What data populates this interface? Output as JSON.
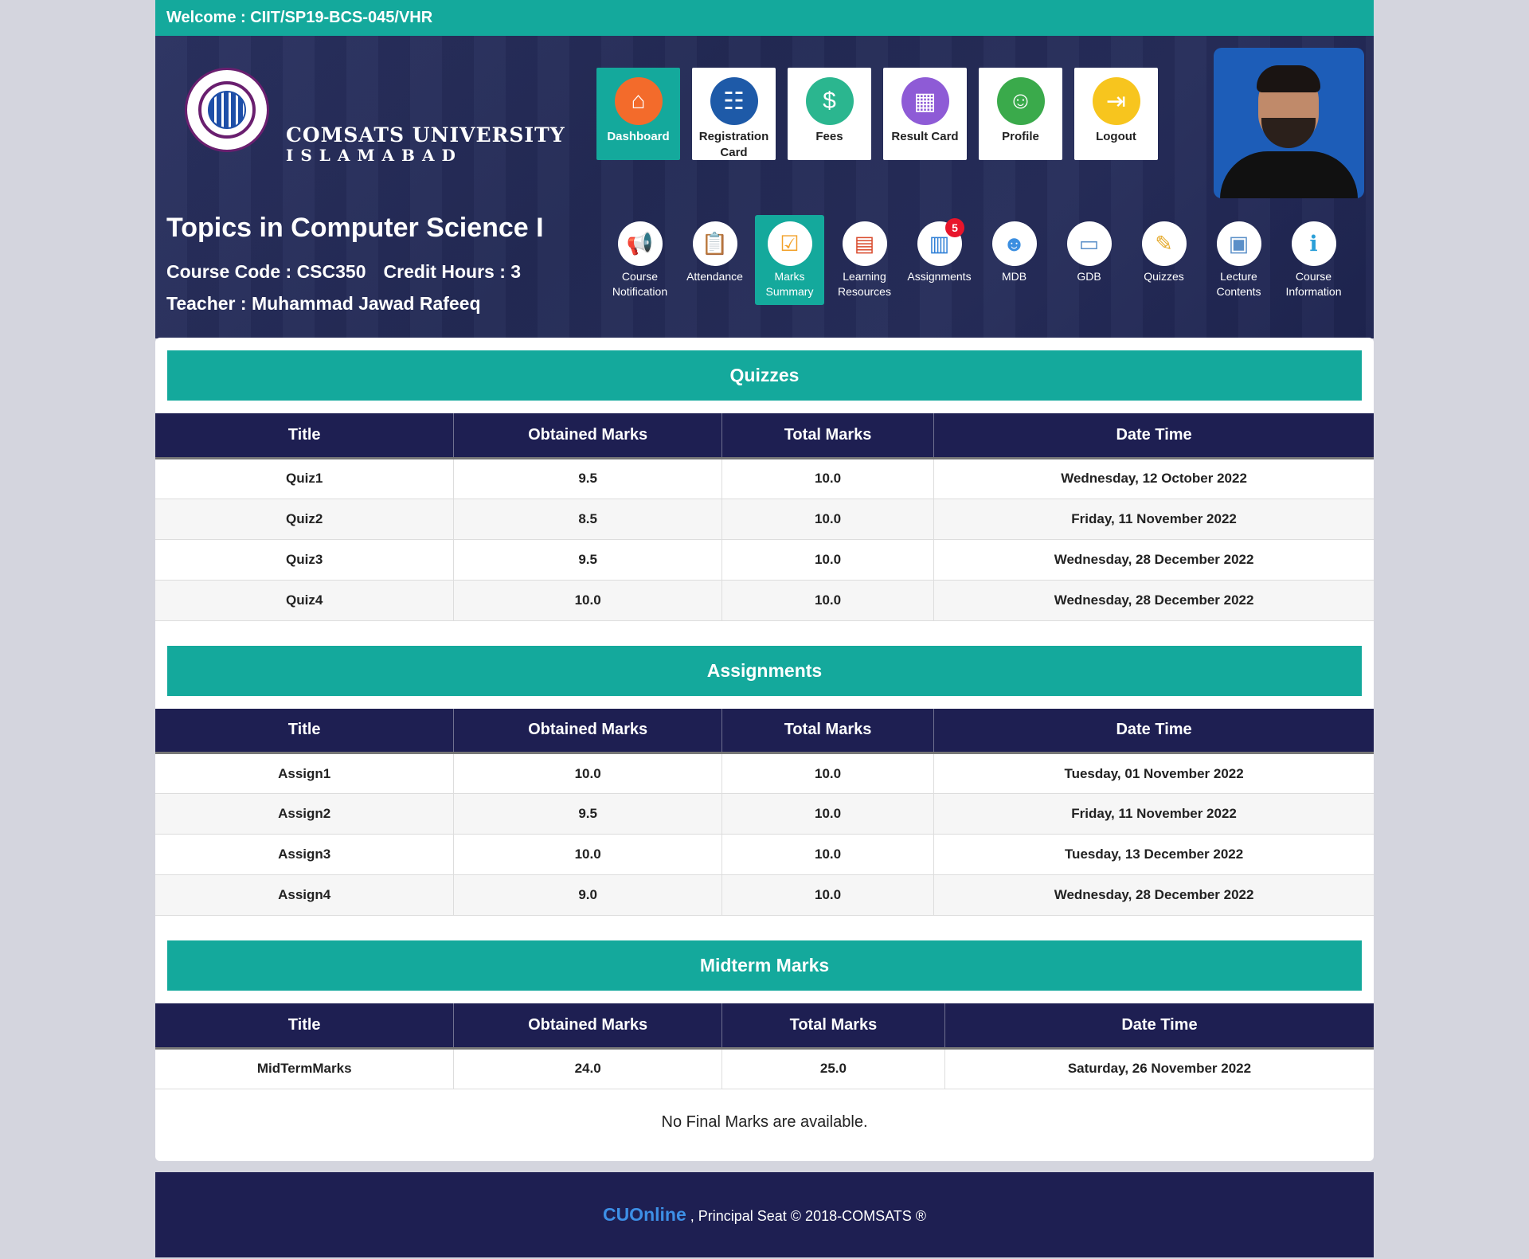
{
  "welcome": "Welcome : CIIT/SP19-BCS-045/VHR",
  "brand": {
    "line1": "COMSATS UNIVERSITY",
    "line2": "ISLAMABAD"
  },
  "topnav": [
    {
      "label": "Dashboard",
      "icon": "home-icon",
      "color": "#f36b2b",
      "active": true
    },
    {
      "label": "Registration Card",
      "icon": "registration-icon",
      "color": "#1e5aa8",
      "active": false
    },
    {
      "label": "Fees",
      "icon": "fees-icon",
      "color": "#2bb68f",
      "active": false
    },
    {
      "label": "Result Card",
      "icon": "result-card-icon",
      "color": "#8e5bd6",
      "active": false
    },
    {
      "label": "Profile",
      "icon": "profile-icon",
      "color": "#3aaa4b",
      "active": false
    },
    {
      "label": "Logout",
      "icon": "logout-icon",
      "color": "#f7c51e",
      "active": false
    }
  ],
  "course": {
    "title": "Topics in Computer Science I",
    "code": "Course Code : CSC350",
    "credit": "Credit Hours : 3",
    "teacher": "Teacher : Muhammad Jawad Rafeeq"
  },
  "subnav": [
    {
      "label": "Course Notification",
      "icon": "megaphone-icon",
      "active": false
    },
    {
      "label": "Attendance",
      "icon": "clipboard-icon",
      "active": false
    },
    {
      "label": "Marks Summary",
      "icon": "marks-summary-icon",
      "active": true
    },
    {
      "label": "Learning Resources",
      "icon": "learning-resources-icon",
      "active": false
    },
    {
      "label": "Assignments",
      "icon": "assignments-icon",
      "active": false,
      "badge": "5"
    },
    {
      "label": "MDB",
      "icon": "mdb-icon",
      "active": false
    },
    {
      "label": "GDB",
      "icon": "gdb-icon",
      "active": false
    },
    {
      "label": "Quizzes",
      "icon": "quizzes-icon",
      "active": false
    },
    {
      "label": "Lecture Contents",
      "icon": "lecture-contents-icon",
      "active": false
    },
    {
      "label": "Course Information",
      "icon": "info-icon",
      "active": false
    }
  ],
  "headers": [
    "Title",
    "Obtained Marks",
    "Total Marks",
    "Date Time"
  ],
  "quizzes": {
    "heading": "Quizzes",
    "rows": [
      [
        "Quiz1",
        "9.5",
        "10.0",
        "Wednesday, 12 October 2022"
      ],
      [
        "Quiz2",
        "8.5",
        "10.0",
        "Friday, 11 November 2022"
      ],
      [
        "Quiz3",
        "9.5",
        "10.0",
        "Wednesday, 28 December 2022"
      ],
      [
        "Quiz4",
        "10.0",
        "10.0",
        "Wednesday, 28 December 2022"
      ]
    ]
  },
  "assignments": {
    "heading": "Assignments",
    "rows": [
      [
        "Assign1",
        "10.0",
        "10.0",
        "Tuesday, 01 November 2022"
      ],
      [
        "Assign2",
        "9.5",
        "10.0",
        "Friday, 11 November 2022"
      ],
      [
        "Assign3",
        "10.0",
        "10.0",
        "Tuesday, 13 December 2022"
      ],
      [
        "Assign4",
        "9.0",
        "10.0",
        "Wednesday, 28 December 2022"
      ]
    ]
  },
  "midterm": {
    "heading": "Midterm Marks",
    "rows": [
      [
        "MidTermMarks",
        "24.0",
        "25.0",
        "Saturday, 26 November 2022"
      ]
    ]
  },
  "final_message": "No Final Marks are available.",
  "footer": {
    "brand": "CUOnline",
    "text": " , Principal Seat © 2018-COMSATS ®"
  },
  "colors": {
    "teal": "#14a99c",
    "navy": "#1e1f52",
    "footer_brand": "#3d8fe6"
  }
}
